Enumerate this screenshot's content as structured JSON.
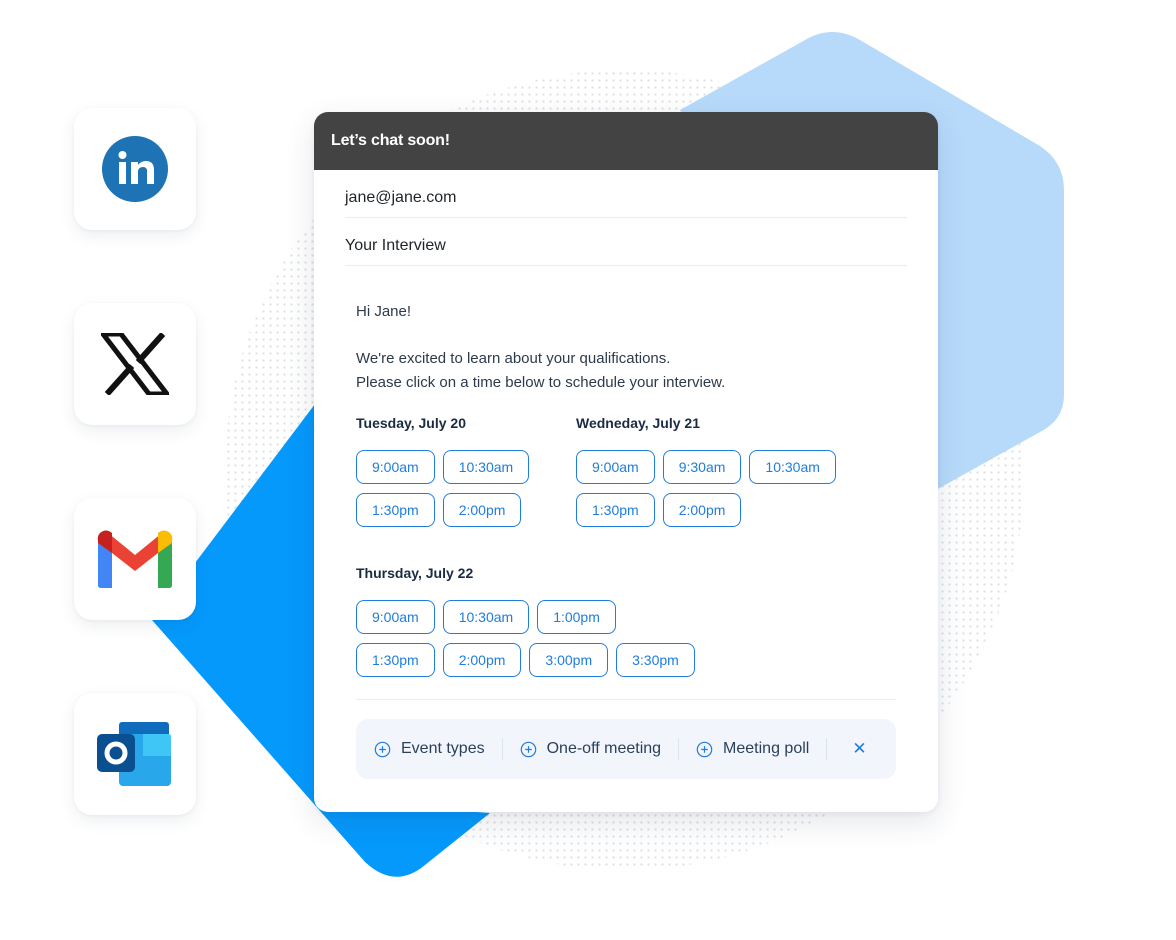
{
  "colors": {
    "accent": "#1f7de0",
    "header_bg": "#434343",
    "blob_light": "#b7dafb",
    "blob_dark": "#0599fc",
    "toolbar_bg": "#f2f6fc"
  },
  "apps": [
    {
      "name": "LinkedIn",
      "icon": "linkedin-icon"
    },
    {
      "name": "X",
      "icon": "x-icon"
    },
    {
      "name": "Gmail",
      "icon": "gmail-icon"
    },
    {
      "name": "Outlook",
      "icon": "outlook-icon"
    }
  ],
  "email": {
    "header_title": "Let’s chat soon!",
    "to": "jane@jane.com",
    "subject": "Your Interview",
    "greeting": "Hi Jane!",
    "intro_line1": "We're excited to learn about your qualifications.",
    "intro_line2": "Please click on a time below to schedule your interview.",
    "days": [
      {
        "title": "Tuesday, July 20",
        "rows": [
          [
            "9:00am",
            "10:30am"
          ],
          [
            "1:30pm",
            "2:00pm"
          ]
        ]
      },
      {
        "title": "Wedneday, July 21",
        "rows": [
          [
            "9:00am",
            "9:30am",
            "10:30am"
          ],
          [
            "1:30pm",
            "2:00pm"
          ]
        ]
      },
      {
        "title": "Thursday, July 22",
        "rows": [
          [
            "9:00am",
            "10:30am",
            "1:00pm"
          ],
          [
            "1:30pm",
            "2:00pm",
            "3:00pm",
            "3:30pm"
          ]
        ]
      }
    ]
  },
  "toolbar": {
    "items": [
      {
        "label": "Event types",
        "icon": "plus-circle-icon"
      },
      {
        "label": "One-off meeting",
        "icon": "plus-circle-icon"
      },
      {
        "label": "Meeting poll",
        "icon": "plus-circle-icon"
      }
    ],
    "close_label": "✕"
  }
}
